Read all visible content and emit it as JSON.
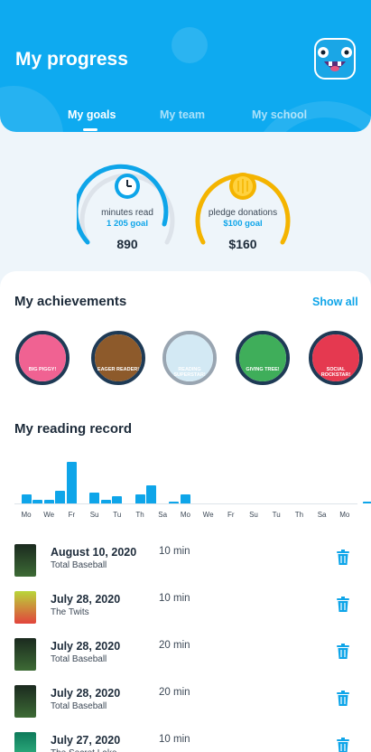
{
  "header": {
    "title": "My progress",
    "tabs": [
      {
        "label": "My goals",
        "active": true
      },
      {
        "label": "My team",
        "active": false
      },
      {
        "label": "My school",
        "active": false
      }
    ]
  },
  "goals": [
    {
      "label": "minutes read",
      "goal": "1 205 goal",
      "value": "890",
      "progress": 0.74,
      "color": "#0ea5e9",
      "icon": "clock-icon"
    },
    {
      "label": "pledge donations",
      "goal": "$100 goal",
      "value": "$160",
      "progress": 1.0,
      "color": "#f4b400",
      "icon": "coin-icon"
    }
  ],
  "achievements": {
    "title": "My achievements",
    "show_all": "Show all",
    "badges": [
      {
        "label": "BIG PIGGY!",
        "color": "#f06292",
        "earned": true
      },
      {
        "label": "EAGER READER!",
        "color": "#8d5a2b",
        "earned": true
      },
      {
        "label": "READING SUPERSTAR!",
        "color": "#9ecfe8",
        "earned": false
      },
      {
        "label": "GIVING TREE!",
        "color": "#3fae5a",
        "earned": true
      },
      {
        "label": "SOCIAL ROCKSTAR!",
        "color": "#e53950",
        "earned": true
      }
    ]
  },
  "reading_record": {
    "title": "My reading record",
    "chart_data": {
      "type": "bar",
      "categories": [
        "Mo",
        "Tu",
        "We",
        "Th",
        "Fr",
        "Sa",
        "Su",
        "Mo",
        "Tu",
        "We",
        "Th",
        "Fr",
        "Sa",
        "Su",
        "Mo",
        "Tu",
        "We",
        "Th",
        "Fr",
        "Sa",
        "Su",
        "Mo",
        "Tu",
        "We",
        "Th",
        "Fr",
        "Sa",
        "Su",
        "Mo",
        "Tu",
        "We"
      ],
      "tick_labels": [
        "Mo",
        "We",
        "Fr",
        "Su",
        "Tu",
        "Th",
        "Sa",
        "Mo",
        "We",
        "Fr",
        "Su",
        "Tu",
        "Th",
        "Sa",
        "Mo"
      ],
      "values": [
        10,
        4,
        4,
        14,
        45,
        0,
        12,
        4,
        8,
        0,
        10,
        20,
        0,
        2,
        10,
        0,
        0,
        0,
        0,
        0,
        0,
        0,
        0,
        0,
        0,
        0,
        0,
        0,
        0,
        0,
        2
      ],
      "ylim": [
        0,
        45
      ],
      "color": "#0ea5e9"
    },
    "entries": [
      {
        "date": "August 10, 2020",
        "book": "Total Baseball",
        "minutes": "10 min",
        "cover": "baseball"
      },
      {
        "date": "July 28, 2020",
        "book": "The Twits",
        "minutes": "10 min",
        "cover": "twits"
      },
      {
        "date": "July 28, 2020",
        "book": "Total Baseball",
        "minutes": "20 min",
        "cover": "baseball"
      },
      {
        "date": "July 28, 2020",
        "book": "Total Baseball",
        "minutes": "20 min",
        "cover": "baseball"
      },
      {
        "date": "July 27, 2020",
        "book": "The Secret Lake",
        "minutes": "10 min",
        "cover": "lake"
      }
    ]
  }
}
